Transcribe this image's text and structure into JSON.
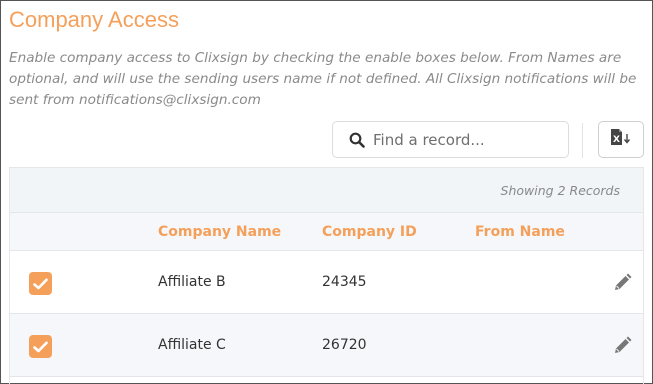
{
  "page": {
    "title": "Company Access",
    "description": "Enable company access to Clixsign by checking the enable boxes below. From Names are optional, and will use the sending users name if not defined. All Clixsign notifications will be sent from notifications@clixsign.com"
  },
  "search": {
    "placeholder": "Find a record...",
    "value": "",
    "icon": "search-icon"
  },
  "toolbar": {
    "export_icon": "excel-export-icon"
  },
  "grid": {
    "records_label": "Showing 2 Records",
    "columns": [
      "Company Name",
      "Company ID",
      "From Name"
    ],
    "rows": [
      {
        "enabled": true,
        "company_name": "Affiliate B",
        "company_id": "24345",
        "from_name": ""
      },
      {
        "enabled": true,
        "company_name": "Affiliate C",
        "company_id": "26720",
        "from_name": ""
      }
    ]
  },
  "colors": {
    "accent": "#f5a05a",
    "muted_text": "#8a8a8a",
    "header_bg": "#f2f5f8"
  }
}
